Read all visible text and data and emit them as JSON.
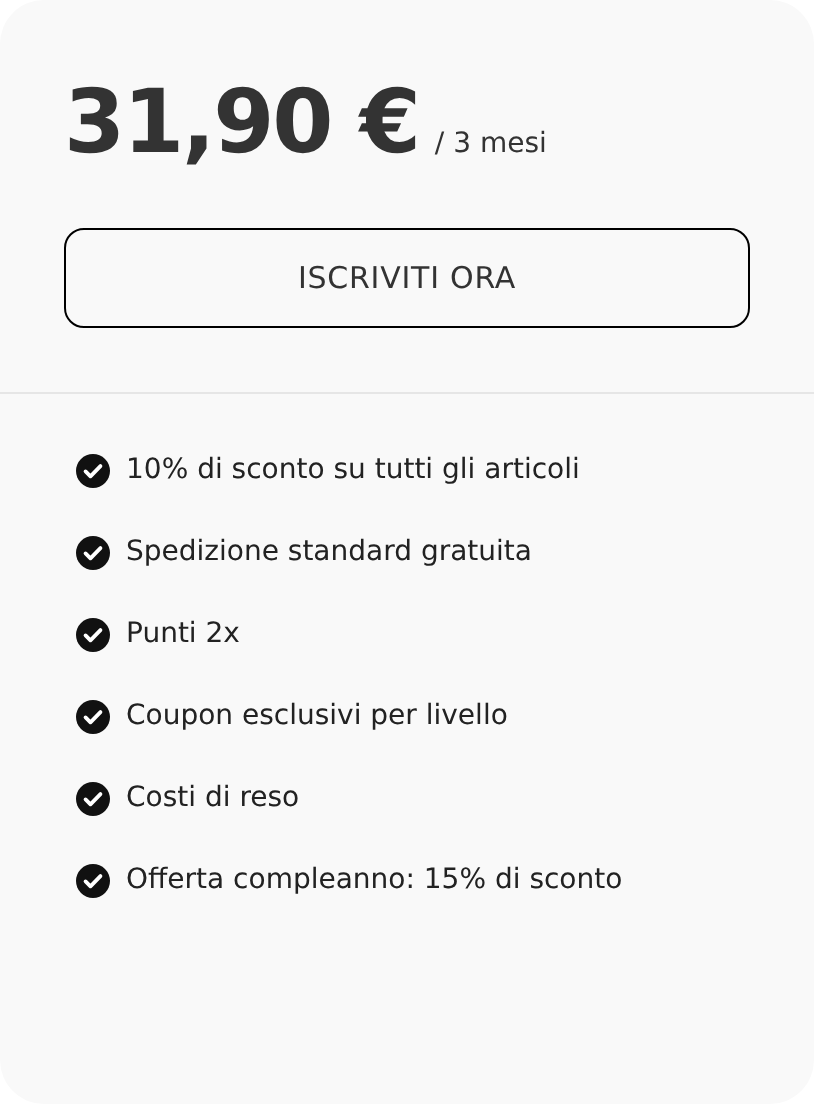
{
  "price": {
    "amount": "31,90 €",
    "period": "/ 3 mesi"
  },
  "cta": {
    "label": "ISCRIVITI ORA"
  },
  "benefits": [
    {
      "text": "10% di sconto su tutti gli articoli"
    },
    {
      "text": "Spedizione standard gratuita"
    },
    {
      "text": "Punti 2x"
    },
    {
      "text": "Coupon esclusivi per livello"
    },
    {
      "text": "Costi di reso"
    },
    {
      "text": "Offerta compleanno: 15% di sconto"
    }
  ]
}
